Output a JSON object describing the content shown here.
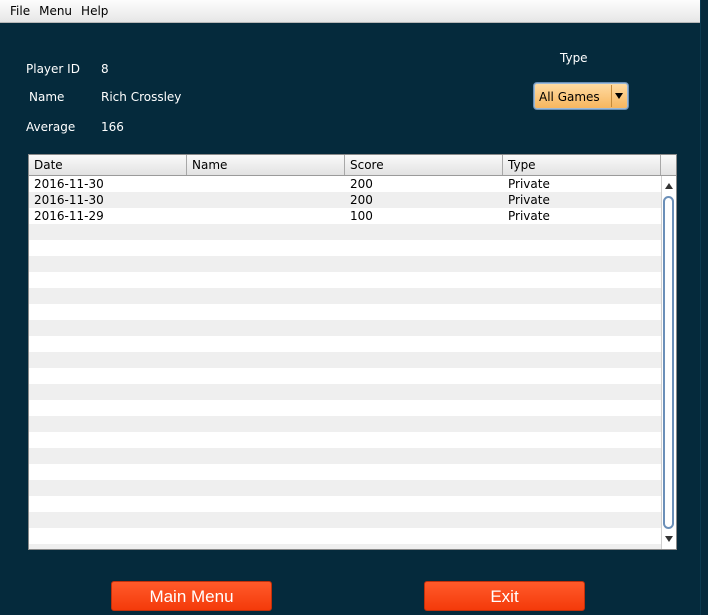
{
  "menubar": {
    "items": [
      "File",
      "Menu",
      "Help"
    ]
  },
  "player": {
    "id_label": "Player ID",
    "id_value": "8",
    "name_label": "Name",
    "name_value": "Rich Crossley",
    "average_label": "Average",
    "average_value": "166"
  },
  "filter": {
    "label": "Type",
    "selected": "All Games"
  },
  "table": {
    "columns": [
      "Date",
      "Name",
      "Score",
      "Type"
    ],
    "rows": [
      [
        "2016-11-30",
        "",
        "200",
        "Private"
      ],
      [
        "2016-11-30",
        "",
        "200",
        "Private"
      ],
      [
        "2016-11-29",
        "",
        "100",
        "Private"
      ]
    ]
  },
  "buttons": {
    "main_menu": "Main Menu",
    "exit": "Exit"
  },
  "colors": {
    "background": "#052a3c",
    "button": "#f9461a",
    "combo": "#fcc47e"
  }
}
